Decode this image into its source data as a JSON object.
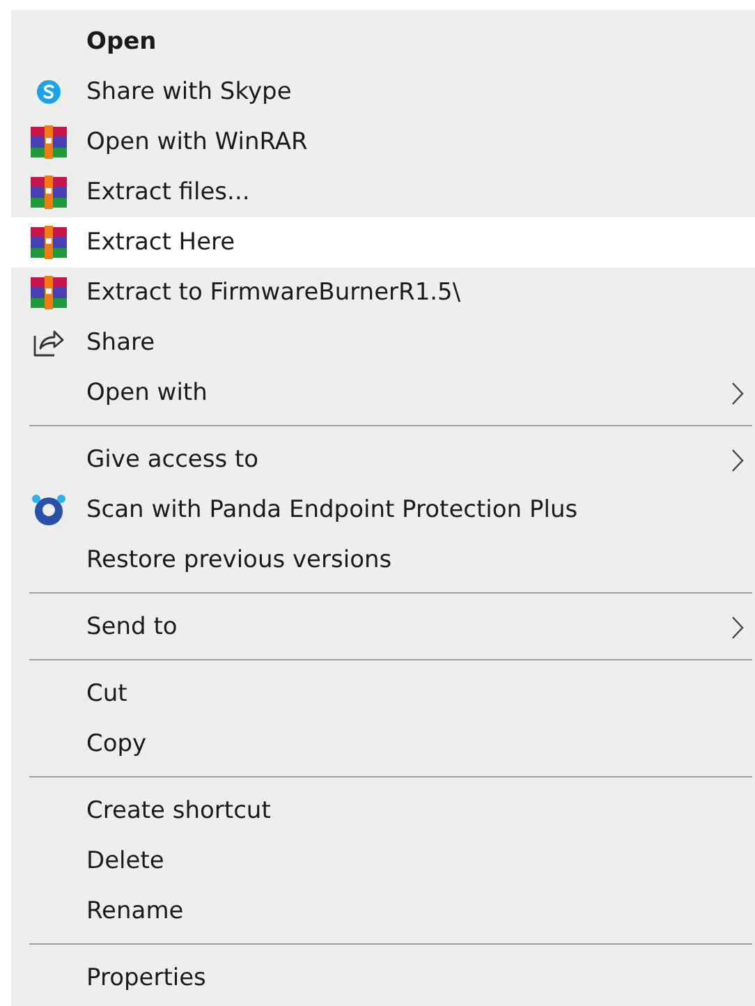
{
  "menu": {
    "groups": [
      {
        "items": [
          {
            "label": "Open",
            "kind": "plain",
            "default": true,
            "submenu": false,
            "selected": false
          },
          {
            "label": "Share with Skype",
            "kind": "skype",
            "default": false,
            "submenu": false,
            "selected": false
          },
          {
            "label": "Open with WinRAR",
            "kind": "archive",
            "default": false,
            "submenu": false,
            "selected": false
          },
          {
            "label": "Extract files...",
            "kind": "archive",
            "default": false,
            "submenu": false,
            "selected": false
          },
          {
            "label": "Extract Here",
            "kind": "archive",
            "default": false,
            "submenu": false,
            "selected": true
          },
          {
            "label": "Extract to FirmwareBurnerR1.5\\",
            "kind": "archive",
            "default": false,
            "submenu": false,
            "selected": false
          },
          {
            "label": "Share",
            "kind": "share",
            "default": false,
            "submenu": false,
            "selected": false
          },
          {
            "label": "Open with",
            "kind": "plain",
            "default": false,
            "submenu": true,
            "selected": false
          }
        ]
      },
      {
        "items": [
          {
            "label": "Give access to",
            "kind": "plain",
            "default": false,
            "submenu": true,
            "selected": false
          },
          {
            "label": "Scan with Panda Endpoint Protection Plus",
            "kind": "scan",
            "default": false,
            "submenu": false,
            "selected": false
          },
          {
            "label": "Restore previous versions",
            "kind": "plain",
            "default": false,
            "submenu": false,
            "selected": false
          }
        ]
      },
      {
        "items": [
          {
            "label": "Send to",
            "kind": "plain",
            "default": false,
            "submenu": true,
            "selected": false
          }
        ]
      },
      {
        "items": [
          {
            "label": "Cut",
            "kind": "plain",
            "default": false,
            "submenu": false,
            "selected": false
          },
          {
            "label": "Copy",
            "kind": "plain",
            "default": false,
            "submenu": false,
            "selected": false
          }
        ]
      },
      {
        "items": [
          {
            "label": "Create shortcut",
            "kind": "plain",
            "default": false,
            "submenu": false,
            "selected": false
          },
          {
            "label": "Delete",
            "kind": "plain",
            "default": false,
            "submenu": false,
            "selected": false
          },
          {
            "label": "Rename",
            "kind": "plain",
            "default": false,
            "submenu": false,
            "selected": false
          }
        ]
      },
      {
        "items": [
          {
            "label": "Properties",
            "kind": "plain",
            "default": false,
            "submenu": false,
            "selected": false
          }
        ]
      }
    ]
  }
}
